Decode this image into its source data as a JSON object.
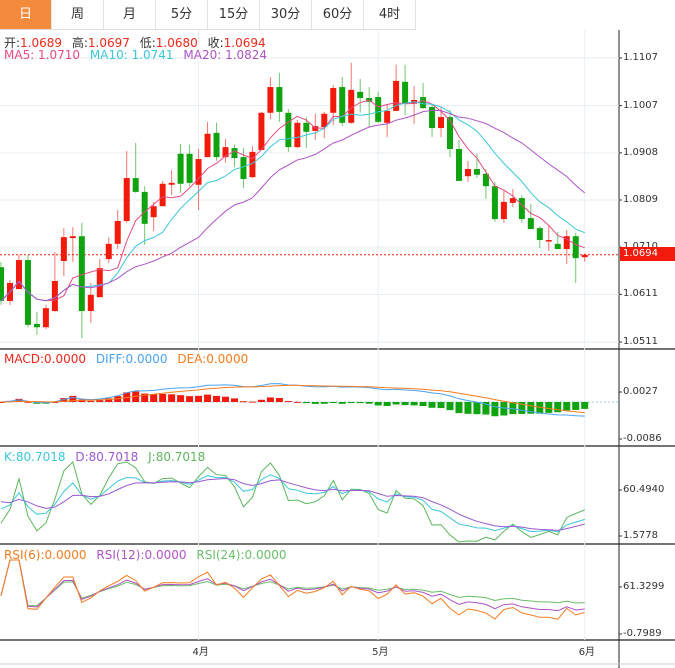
{
  "tabs": [
    {
      "label": "日",
      "active": true
    },
    {
      "label": "周"
    },
    {
      "label": "月"
    },
    {
      "label": "5分"
    },
    {
      "label": "15分"
    },
    {
      "label": "30分"
    },
    {
      "label": "60分"
    },
    {
      "label": "4时"
    }
  ],
  "ohlc_header": {
    "open_label": "开:",
    "open": "1.0689",
    "high_label": "高:",
    "high": "1.0697",
    "low_label": "低:",
    "low": "1.0680",
    "close_label": "收:",
    "close": "1.0694"
  },
  "ma_legend": {
    "ma5": "MA5: 1.0710",
    "ma10": "MA10: 1.0741",
    "ma20": "MA20: 1.0824"
  },
  "macd_legend": {
    "macd": "MACD:0.0000",
    "diff": "DIFF:0.0000",
    "dea": "DEA:0.0000"
  },
  "kdj_legend": {
    "k": "K:80.7018",
    "d": "D:80.7018",
    "j": "J:80.7018"
  },
  "rsi_legend": {
    "rsi6": "RSI(6):0.0000",
    "rsi12": "RSI(12):0.0000",
    "rsi24": "RSI(24):0.0000"
  },
  "price_axis": [
    "1.1107",
    "1.1007",
    "1.0908",
    "1.0809",
    "1.0710",
    "1.0611",
    "1.0511"
  ],
  "current_price": "1.0694",
  "macd_axis": [
    "0.0027",
    "-0.0086"
  ],
  "kdj_axis": [
    "60.4940",
    "1.5778"
  ],
  "rsi_axis": [
    "61.3299",
    "-0.7989"
  ],
  "x_axis": [
    {
      "label": "4月",
      "index": 22
    },
    {
      "label": "5月",
      "index": 42
    },
    {
      "label": "6月",
      "index": 65
    }
  ],
  "colors": {
    "up": "#f21a0a",
    "down": "#0fa30f",
    "ma5": "#e84a83",
    "ma10": "#3cc6de",
    "ma20": "#b054c8",
    "diff": "#4aa3f0",
    "dea": "#f57c1f",
    "k": "#3cc6de",
    "d": "#9b59d0",
    "j": "#5cb85c",
    "rsi6": "#f57c1f",
    "rsi12": "#b054c8",
    "rsi24": "#6abf6a",
    "active_tab": "#f48a3c"
  },
  "chart_data": {
    "type": "candlestick",
    "price_range": [
      1.0511,
      1.1107
    ],
    "candles": [
      [
        1.0668,
        1.0679,
        1.0589,
        1.0597
      ],
      [
        1.0597,
        1.0641,
        1.0589,
        1.0635
      ],
      [
        1.0622,
        1.0694,
        1.0622,
        1.0683
      ],
      [
        1.0683,
        1.0694,
        1.0542,
        1.0547
      ],
      [
        1.0549,
        1.0574,
        1.0526,
        1.0542
      ],
      [
        1.0542,
        1.0589,
        1.0538,
        1.0582
      ],
      [
        1.0576,
        1.07,
        1.0574,
        1.0639
      ],
      [
        1.0681,
        1.075,
        1.0649,
        1.0731
      ],
      [
        1.0729,
        1.0752,
        1.0679,
        1.0733
      ],
      [
        1.0733,
        1.0761,
        1.0519,
        1.0576
      ],
      [
        1.0576,
        1.0635,
        1.0551,
        1.061
      ],
      [
        1.0605,
        1.0685,
        1.0605,
        1.0666
      ],
      [
        1.0685,
        1.0731,
        1.0677,
        1.0717
      ],
      [
        1.0717,
        1.0788,
        1.0706,
        1.0765
      ],
      [
        1.0765,
        1.0912,
        1.0761,
        1.0855
      ],
      [
        1.0855,
        1.0929,
        1.0824,
        1.0826
      ],
      [
        1.0826,
        1.0838,
        1.0715,
        1.0759
      ],
      [
        1.0773,
        1.0805,
        1.0744,
        1.0796
      ],
      [
        1.0796,
        1.0849,
        1.0796,
        1.0843
      ],
      [
        1.0841,
        1.0872,
        1.0819,
        1.0845
      ],
      [
        1.0906,
        1.0927,
        1.0824,
        1.0843
      ],
      [
        1.0906,
        1.0925,
        1.0838,
        1.0845
      ],
      [
        1.0841,
        1.0916,
        1.0788,
        1.0895
      ],
      [
        1.0899,
        1.0973,
        1.0899,
        1.0948
      ],
      [
        1.095,
        1.0971,
        1.0891,
        1.0899
      ],
      [
        1.0899,
        1.0937,
        1.0887,
        1.092
      ],
      [
        1.0918,
        1.0925,
        1.0878,
        1.0897
      ],
      [
        1.0899,
        1.0918,
        1.0834,
        1.0853
      ],
      [
        1.0857,
        1.0922,
        1.0855,
        1.091
      ],
      [
        1.0914,
        1.0994,
        1.0914,
        1.0992
      ],
      [
        1.0992,
        1.1067,
        1.0979,
        1.1046
      ],
      [
        1.1046,
        1.1076,
        1.0973,
        1.0994
      ],
      [
        1.0992,
        1.1,
        1.091,
        1.092
      ],
      [
        1.092,
        1.0977,
        1.0918,
        1.0971
      ],
      [
        1.0971,
        1.0983,
        1.0918,
        1.0952
      ],
      [
        1.0954,
        1.099,
        1.0935,
        1.0964
      ],
      [
        1.0962,
        1.0994,
        1.0939,
        1.099
      ],
      [
        1.0992,
        1.105,
        1.0966,
        1.1044
      ],
      [
        1.1046,
        1.1067,
        1.0964,
        1.0971
      ],
      [
        1.0971,
        1.1097,
        1.0969,
        1.104
      ],
      [
        1.1036,
        1.1063,
        1.0992,
        1.1023
      ],
      [
        1.1023,
        1.1046,
        1.0962,
        1.1015
      ],
      [
        1.1025,
        1.1036,
        1.0971,
        1.0973
      ],
      [
        1.0971,
        1.1009,
        1.0941,
        1.0996
      ],
      [
        1.0996,
        1.1093,
        1.0996,
        1.1059
      ],
      [
        1.1057,
        1.1093,
        1.0987,
        1.1011
      ],
      [
        1.1011,
        1.1048,
        1.0969,
        1.1019
      ],
      [
        1.1025,
        1.1055,
        1.1,
        1.1002
      ],
      [
        1.1004,
        1.1009,
        1.0941,
        1.096
      ],
      [
        1.096,
        1.1004,
        1.0941,
        1.0983
      ],
      [
        1.0983,
        1.0998,
        1.0899,
        1.0916
      ],
      [
        1.0916,
        1.0935,
        1.0849,
        1.0849
      ],
      [
        1.0859,
        1.0891,
        1.0847,
        1.0874
      ],
      [
        1.0874,
        1.0906,
        1.0855,
        1.0862
      ],
      [
        1.0864,
        1.0874,
        1.0811,
        1.0838
      ],
      [
        1.0838,
        1.0847,
        1.0763,
        1.0769
      ],
      [
        1.0769,
        1.083,
        1.0761,
        1.0805
      ],
      [
        1.0803,
        1.0832,
        1.0794,
        1.0813
      ],
      [
        1.0813,
        1.0819,
        1.0761,
        1.0769
      ],
      [
        1.0771,
        1.0801,
        1.0748,
        1.0748
      ],
      [
        1.075,
        1.0754,
        1.0708,
        1.0725
      ],
      [
        1.0723,
        1.0757,
        1.0702,
        1.0725
      ],
      [
        1.0717,
        1.0742,
        1.0706,
        1.0706
      ],
      [
        1.0706,
        1.0746,
        1.0675,
        1.0733
      ],
      [
        1.0733,
        1.074,
        1.0635,
        1.0687
      ],
      [
        1.0689,
        1.0697,
        1.068,
        1.0694
      ]
    ],
    "candle_fields": [
      "open",
      "high",
      "low",
      "close"
    ],
    "overlays": [
      "MA5",
      "MA10",
      "MA20"
    ],
    "indicators": [
      "MACD",
      "KDJ",
      "RSI"
    ],
    "grid": true
  }
}
